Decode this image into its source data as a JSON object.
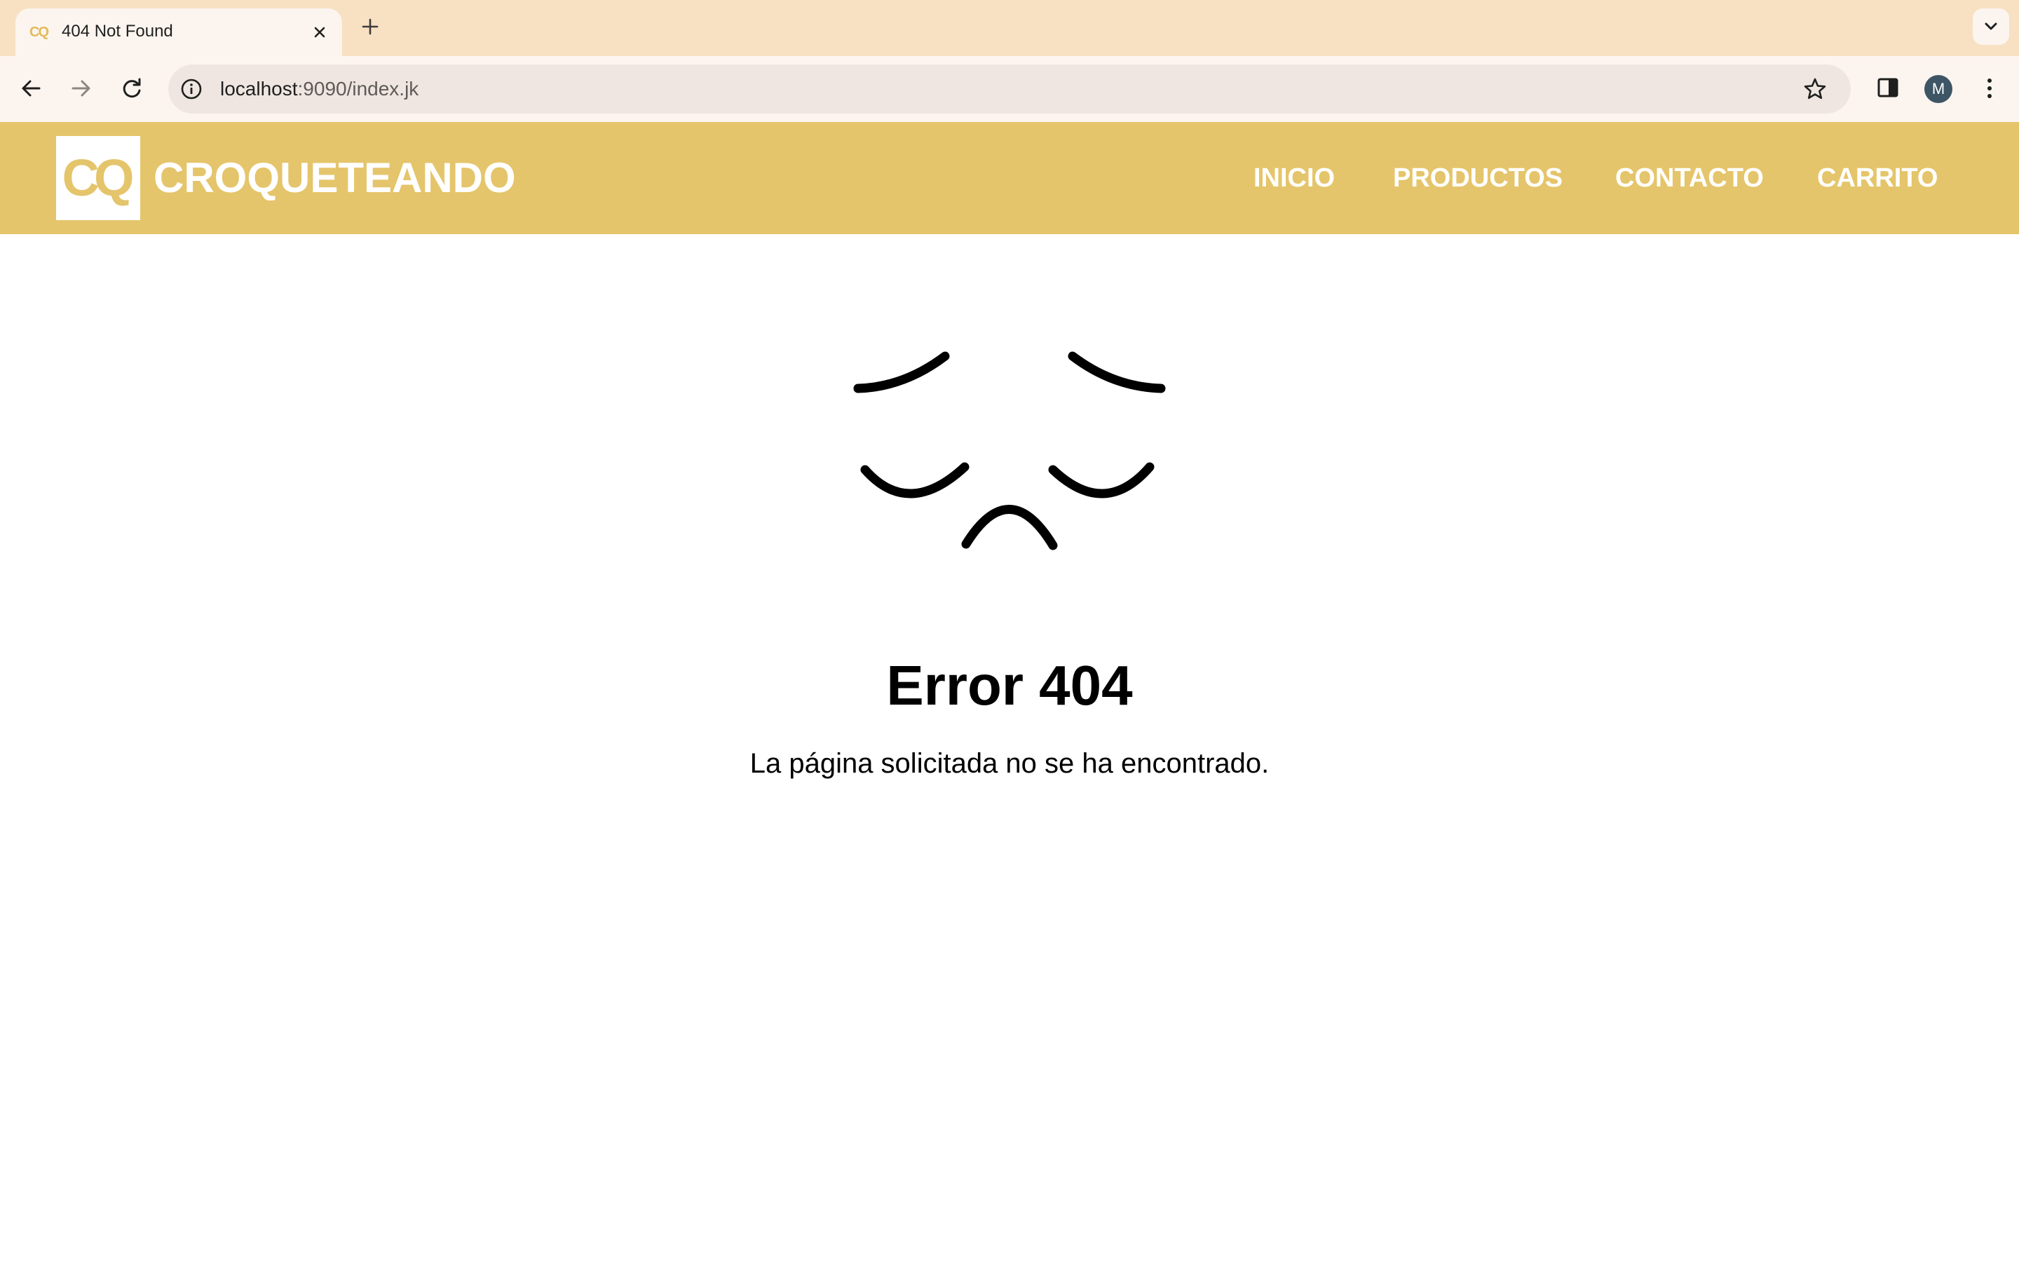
{
  "browser": {
    "tab": {
      "favicon_text": "CQ",
      "title": "404 Not Found"
    },
    "address_bar": {
      "host": "localhost",
      "path": ":9090/index.jk"
    },
    "profile_initial": "M",
    "icons": {
      "back": "arrow-left-icon",
      "forward": "arrow-right-icon",
      "reload": "reload-icon",
      "site_info": "info-icon",
      "bookmark": "star-icon",
      "side_panel": "side-panel-icon",
      "menu": "kebab-menu-icon",
      "tab_search": "chevron-down-icon"
    }
  },
  "site": {
    "logo_text": "CQ",
    "brand": "CROQUETEANDO",
    "nav": {
      "inicio": "INICIO",
      "productos": "PRODUCTOS",
      "contacto": "CONTACTO",
      "carrito": "CARRITO"
    },
    "colors": {
      "header_bg": "#e5c56b",
      "header_text": "#ffffff"
    }
  },
  "error": {
    "illustration": "sad-face-icon",
    "title": "Error 404",
    "message": "La página solicitada no se ha encontrado."
  }
}
